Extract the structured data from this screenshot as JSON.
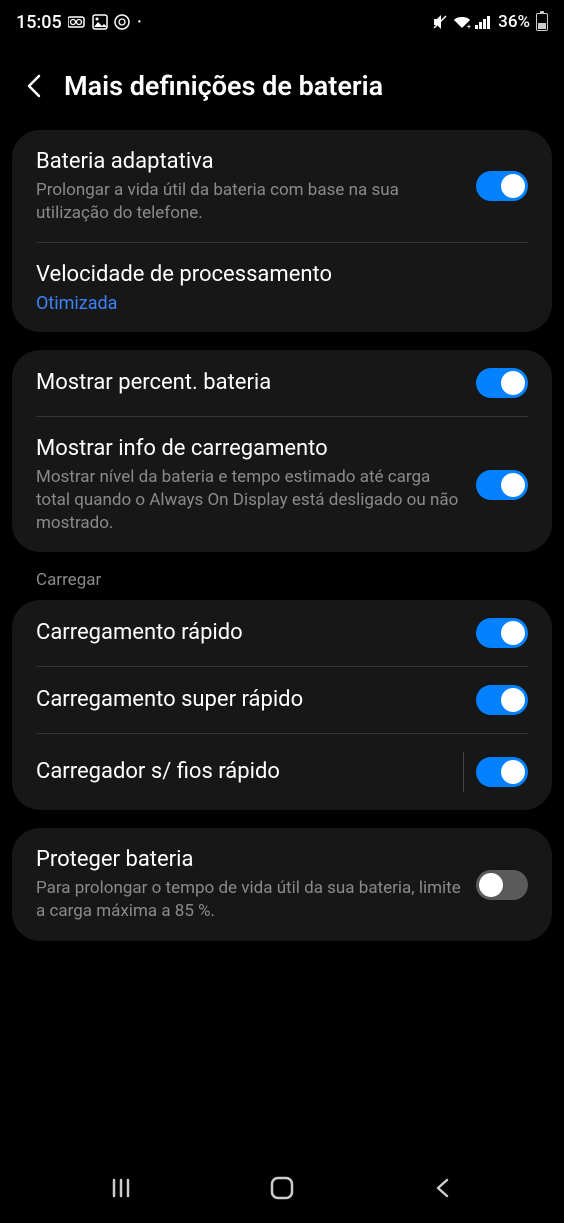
{
  "status": {
    "time": "15:05",
    "battery_pct": "36%"
  },
  "header": {
    "title": "Mais definições de bateria"
  },
  "sections": {
    "s1": {
      "adaptive_title": "Bateria adaptativa",
      "adaptive_desc": "Prolongar a vida útil da bateria com base na sua utilização do telefone.",
      "speed_title": "Velocidade de processamento",
      "speed_value": "Otimizada"
    },
    "s2": {
      "show_pct_title": "Mostrar percent. bateria",
      "show_charge_title": "Mostrar info de carregamento",
      "show_charge_desc": "Mostrar nível da bateria e tempo estimado até carga total quando o Always On Display está desligado ou não mostrado."
    },
    "s3_label": "Carregar",
    "s3": {
      "fast_title": "Carregamento rápido",
      "super_fast_title": "Carregamento super rápido",
      "wireless_title": "Carregador s/ fios rápido"
    },
    "s4": {
      "protect_title": "Proteger bateria",
      "protect_desc": "Para prolongar o tempo de vida útil da sua bateria, limite a carga máxima a 85 %."
    }
  }
}
